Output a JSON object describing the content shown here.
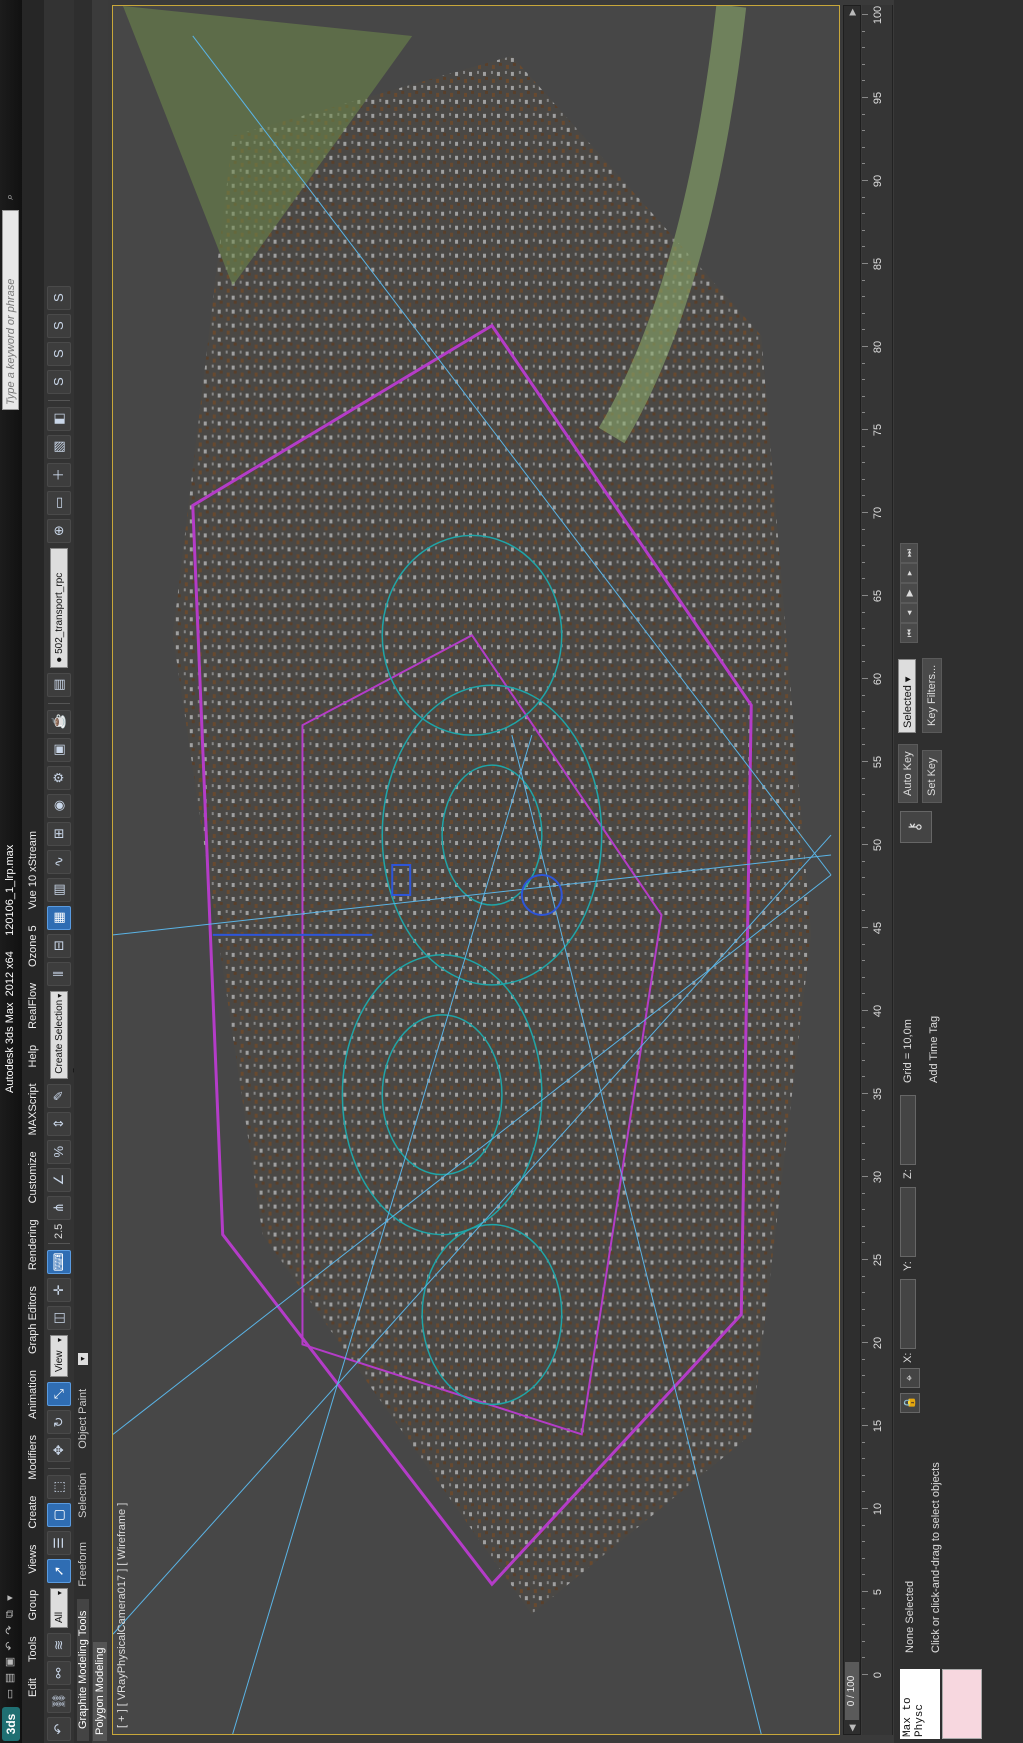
{
  "title_bar": {
    "app_logo": "3ds",
    "title": "Autodesk 3ds Max  2012 x64     120106_1_lrp.max",
    "search_placeholder": "Type a keyword or phrase"
  },
  "menu": [
    "Edit",
    "Tools",
    "Group",
    "Views",
    "Create",
    "Modifiers",
    "Animation",
    "Graph Editors",
    "Rendering",
    "Customize",
    "MAXScript",
    "Help",
    "RealFlow",
    "Ozone 5",
    "Vue 10 xStream"
  ],
  "toolbar": {
    "filter_dropdown": "All",
    "coord_dropdown": "View",
    "snap_value": "2.5",
    "selection_set_placeholder": "Create Selection Se",
    "layer_dropdown": "502_transport_rpc"
  },
  "ribbon": {
    "tabs": [
      "Graphite Modeling Tools",
      "Freeform",
      "Selection",
      "Object Paint"
    ],
    "panel_label": "Polygon Modeling"
  },
  "viewport": {
    "label": "[ + ] [ VRayPhysicalCamera017 ] [ Wireframe ]"
  },
  "time_slider": {
    "frame_readout": "0 / 100"
  },
  "track_ruler": {
    "labels": [
      "0",
      "5",
      "10",
      "15",
      "20",
      "25",
      "30",
      "35",
      "40",
      "45",
      "50",
      "55",
      "60",
      "65",
      "70",
      "75",
      "80",
      "85",
      "90",
      "95",
      "100"
    ]
  },
  "status_bar": {
    "maxscript_text": "Max to Physc",
    "selection_status": "None Selected",
    "prompt": "Click or click-and-drag to select objects",
    "x_label": "X:",
    "y_label": "Y:",
    "z_label": "Z:",
    "grid": "Grid = 10,0m",
    "add_time_tag": "Add Time Tag",
    "auto_key": "Auto Key",
    "set_key": "Set Key",
    "key_mode_dropdown": "Selected",
    "key_filters": "Key Filters..."
  },
  "colors": {
    "accent_blue": "#2f6db3",
    "viewport_border": "#c8a73a",
    "background": "#3a3a3a"
  }
}
